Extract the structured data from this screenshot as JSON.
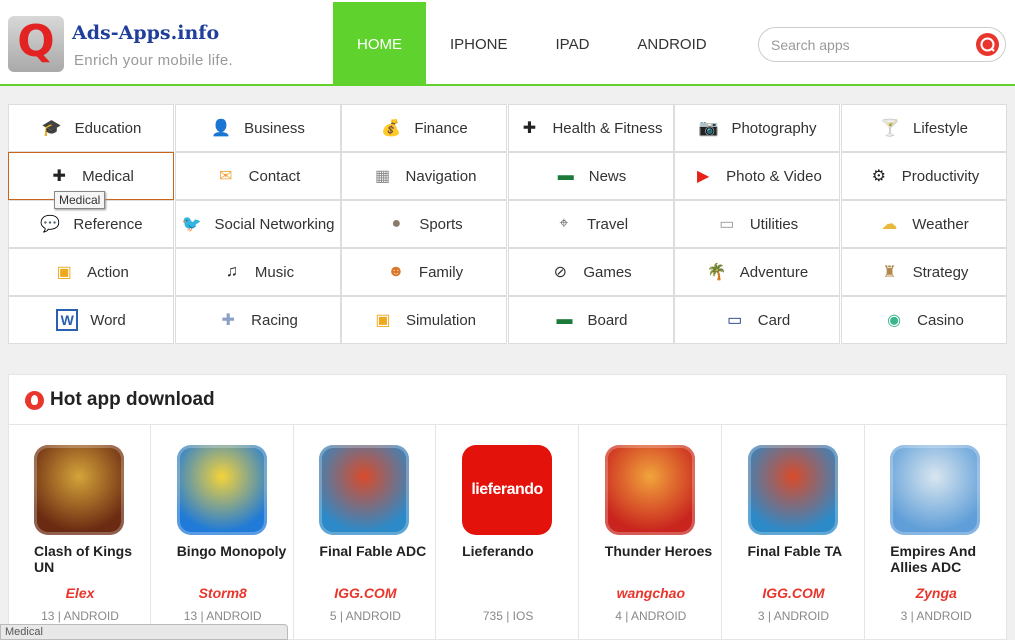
{
  "site": {
    "name": "Ads-Apps.info",
    "tagline": "Enrich your mobile life.",
    "logo_letter": "Q"
  },
  "nav": [
    {
      "label": "HOME",
      "active": true
    },
    {
      "label": "IPHONE",
      "active": false
    },
    {
      "label": "IPAD",
      "active": false
    },
    {
      "label": "ANDROID",
      "active": false
    }
  ],
  "search": {
    "placeholder": "Search apps",
    "value": ""
  },
  "categories": [
    {
      "label": "Education",
      "icon": "graduation-cap-icon"
    },
    {
      "label": "Business",
      "icon": "businessman-icon"
    },
    {
      "label": "Finance",
      "icon": "money-bag-icon"
    },
    {
      "label": "Health & Fitness",
      "icon": "medical-bag-icon"
    },
    {
      "label": "Photography",
      "icon": "camera-icon"
    },
    {
      "label": "Lifestyle",
      "icon": "cocktail-icon"
    },
    {
      "label": "Medical",
      "icon": "medical-bag-icon"
    },
    {
      "label": "Contact",
      "icon": "contact-icon"
    },
    {
      "label": "Navigation",
      "icon": "navigation-icon"
    },
    {
      "label": "News",
      "icon": "board-icon"
    },
    {
      "label": "Photo & Video",
      "icon": "play-icon"
    },
    {
      "label": "Productivity",
      "icon": "gears-icon"
    },
    {
      "label": "Reference",
      "icon": "chat-icon"
    },
    {
      "label": "Social Networking",
      "icon": "twitter-icon"
    },
    {
      "label": "Sports",
      "icon": "ball-icon"
    },
    {
      "label": "Travel",
      "icon": "location-pin-icon"
    },
    {
      "label": "Utilities",
      "icon": "tray-icon"
    },
    {
      "label": "Weather",
      "icon": "sun-cloud-icon"
    },
    {
      "label": "Action",
      "icon": "film-icon"
    },
    {
      "label": "Music",
      "icon": "music-note-icon"
    },
    {
      "label": "Family",
      "icon": "family-icon"
    },
    {
      "label": "Games",
      "icon": "compass-icon"
    },
    {
      "label": "Adventure",
      "icon": "palm-island-icon"
    },
    {
      "label": "Strategy",
      "icon": "chess-icon"
    },
    {
      "label": "Word",
      "icon": "word-icon"
    },
    {
      "label": "Racing",
      "icon": "controller-icon"
    },
    {
      "label": "Simulation",
      "icon": "film-icon"
    },
    {
      "label": "Board",
      "icon": "board-icon"
    },
    {
      "label": "Card",
      "icon": "visa-card-icon"
    },
    {
      "label": "Casino",
      "icon": "casino-chip-icon"
    }
  ],
  "tooltip": "Medical",
  "hot": {
    "title": "Hot app download",
    "apps": [
      {
        "name": "Clash of Kings UN",
        "developer": "Elex",
        "meta": "13 | ANDROID",
        "colors": [
          "#6b2a12",
          "#d5a43a"
        ]
      },
      {
        "name": "Bingo Monopoly",
        "developer": "Storm8",
        "meta": "13 | ANDROID",
        "colors": [
          "#1f7ad8",
          "#f4d33b"
        ]
      },
      {
        "name": "Final Fable ADC",
        "developer": "IGG.COM",
        "meta": "5 | ANDROID",
        "colors": [
          "#2c8ac9",
          "#d94b2a"
        ]
      },
      {
        "name": "Lieferando",
        "developer": "",
        "meta": "735 | IOS",
        "logo_text": "lieferando",
        "colors": [
          "#e3120b",
          "#e3120b"
        ]
      },
      {
        "name": "Thunder Heroes",
        "developer": "wangchao",
        "meta": "4 | ANDROID",
        "colors": [
          "#c9241e",
          "#f1a43c"
        ]
      },
      {
        "name": "Final Fable TA",
        "developer": "IGG.COM",
        "meta": "3 | ANDROID",
        "colors": [
          "#2c8ac9",
          "#d94b2a"
        ]
      },
      {
        "name": "Empires And Allies ADC",
        "developer": "Zynga",
        "meta": "3 | ANDROID",
        "colors": [
          "#5f9ed8",
          "#d9e6ef"
        ]
      }
    ]
  },
  "status_bar": "Medical"
}
